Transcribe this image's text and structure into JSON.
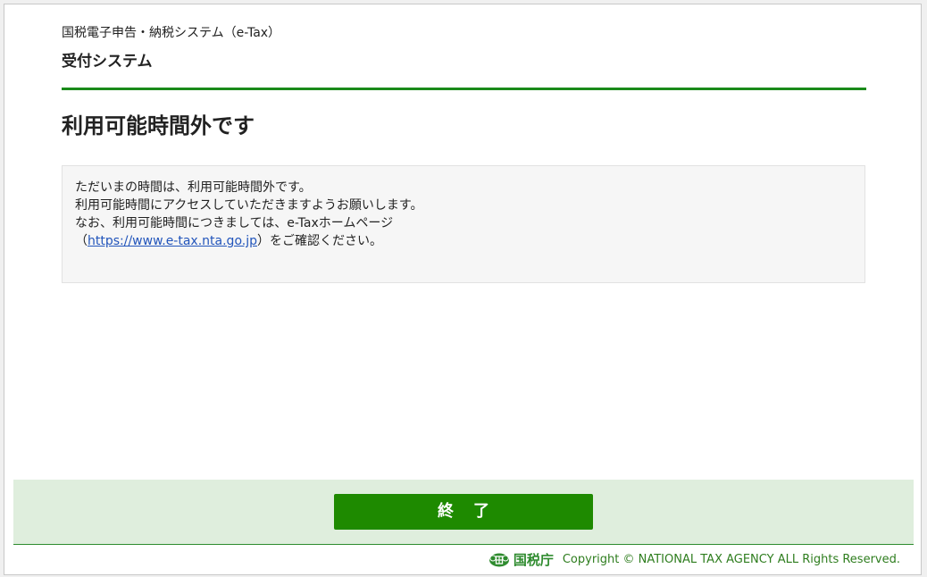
{
  "header": {
    "system_name": "国税電子申告・納税システム（e-Tax）",
    "sub_system": "受付システム"
  },
  "page_title": "利用可能時間外です",
  "message": {
    "line1": "ただいまの時間は、利用可能時間外です。",
    "line2": "利用可能時間にアクセスしていただきますようお願いします。",
    "line3": "なお、利用可能時間につきましては、e-Taxホームページ",
    "line4_prefix": "（",
    "link_text": "https://www.e-tax.nta.go.jp",
    "line4_suffix": "）をご確認ください。"
  },
  "footer": {
    "exit_button_label": "終了",
    "logo_text": "国税庁",
    "logo_icon": "nta-emblem-icon",
    "copyright": "Copyright © NATIONAL TAX AGENCY ALL Rights Reserved."
  },
  "colors": {
    "accent_green": "#1a8a1a",
    "button_green": "#1e8a00",
    "footer_band": "#dfeedd",
    "link_blue": "#2255bb"
  }
}
